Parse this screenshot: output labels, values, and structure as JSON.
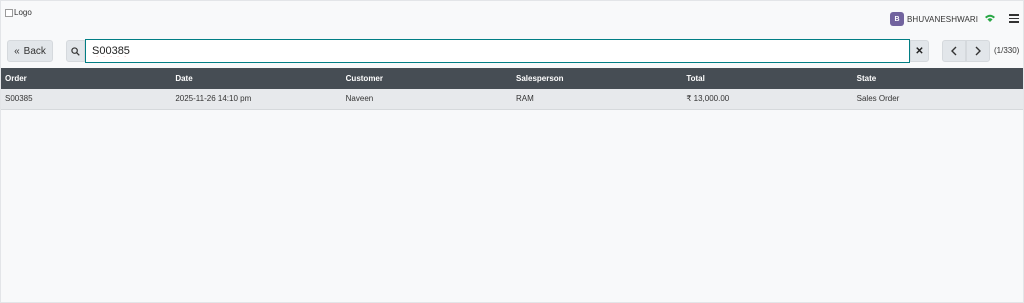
{
  "header": {
    "logo_alt": "Logo",
    "user_initial": "B",
    "user_name": "BHUVANESHWARI",
    "status_color": "#28a745",
    "avatar_color": "#71639e"
  },
  "controls": {
    "back_label": "Back",
    "search_value": "S00385",
    "pager_count": "(1/330)"
  },
  "table": {
    "columns": [
      "Order",
      "Date",
      "Customer",
      "Salesperson",
      "Total",
      "State"
    ],
    "rows": [
      [
        "S00385",
        "2025-11-26 14:10 pm",
        "Naveen",
        "RAM",
        "₹ 13,000.00",
        "Sales Order"
      ]
    ]
  },
  "colors": {
    "header_bg": "#464d54",
    "accent": "#017e84"
  }
}
